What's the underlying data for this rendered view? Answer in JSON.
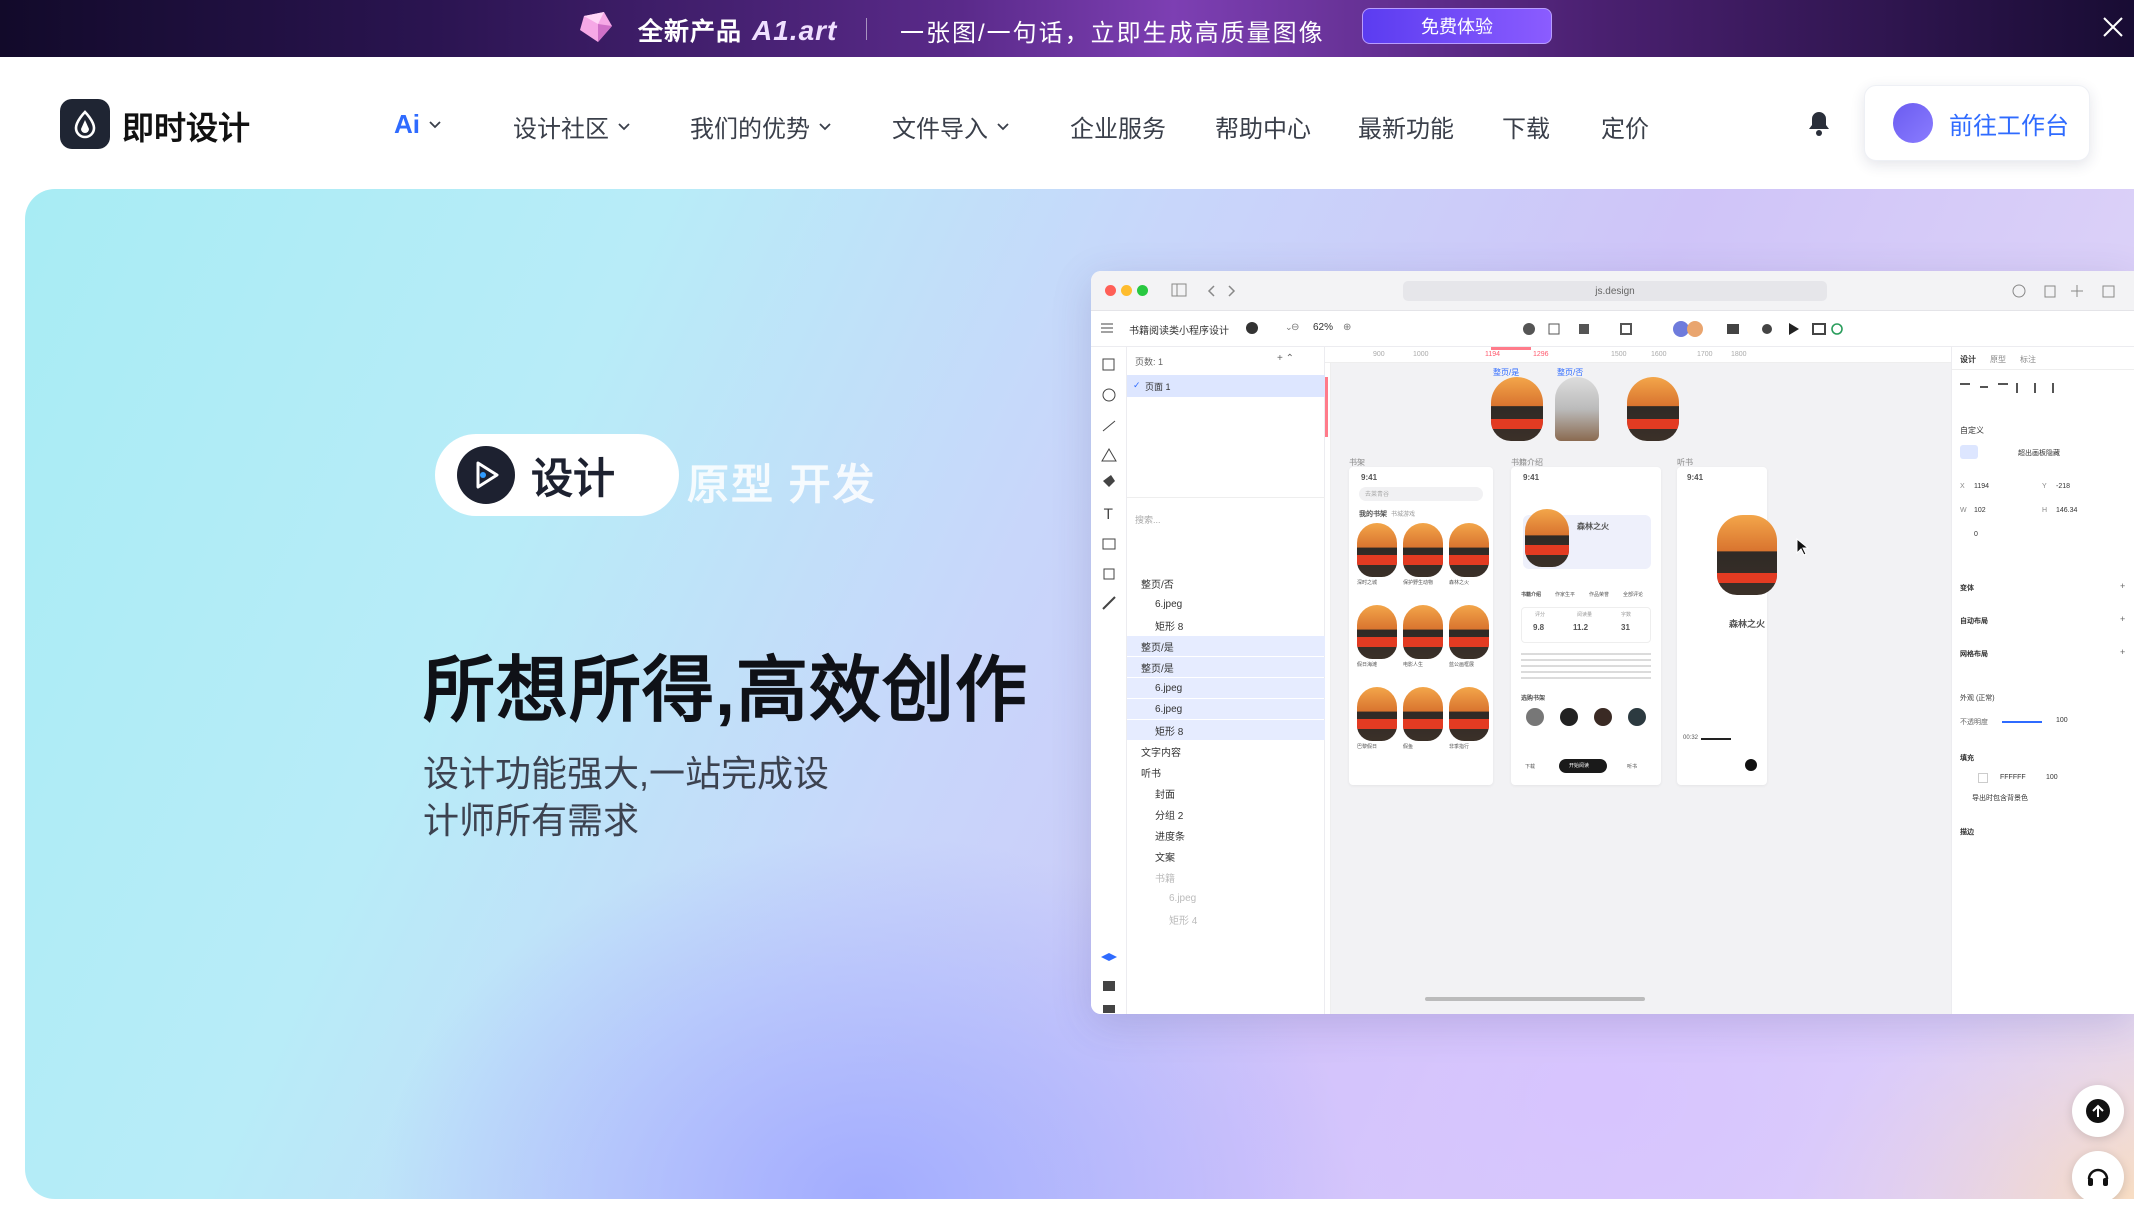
{
  "promo": {
    "title": "全新产品",
    "brand": "A1.art",
    "tagline": "一张图/一句话，立即生成高质量图像",
    "cta": "免费体验"
  },
  "nav": {
    "logo": "即时设计",
    "items": [
      {
        "label": "Ai",
        "dropdown": true
      },
      {
        "label": "设计社区",
        "dropdown": true
      },
      {
        "label": "我们的优势",
        "dropdown": true
      },
      {
        "label": "文件导入",
        "dropdown": true
      },
      {
        "label": "企业服务",
        "dropdown": false
      },
      {
        "label": "帮助中心",
        "dropdown": false
      },
      {
        "label": "最新功能",
        "dropdown": false
      },
      {
        "label": "下载",
        "dropdown": false
      },
      {
        "label": "定价",
        "dropdown": false
      }
    ],
    "workspace_button": "前往工作台"
  },
  "hero": {
    "pill_label": "设计",
    "pill_rest": "原型 开发",
    "headline": "所想所得,高效创作",
    "subline": "设计功能强大,一站完成设计师所有需求"
  },
  "app": {
    "url": "js.design",
    "file_name": "书籍阅读类小程序设计",
    "zoom": "62%",
    "pages_label": "页数: 1",
    "page1": "页面 1",
    "search_placeholder": "搜索...",
    "layers": [
      {
        "label": "整页/否",
        "indent": 0
      },
      {
        "label": "6.jpeg",
        "indent": 1
      },
      {
        "label": "矩形 8",
        "indent": 1
      },
      {
        "label": "整页/是",
        "indent": 0
      },
      {
        "label": "整页/是",
        "indent": 0
      },
      {
        "label": "6.jpeg",
        "indent": 1
      },
      {
        "label": "6.jpeg",
        "indent": 1
      },
      {
        "label": "矩形 8",
        "indent": 1
      },
      {
        "label": "文字内容",
        "indent": 0
      },
      {
        "label": "听书",
        "indent": 0
      },
      {
        "label": "封面",
        "indent": 1
      },
      {
        "label": "分组 2",
        "indent": 1
      },
      {
        "label": "进度条",
        "indent": 1
      },
      {
        "label": "文案",
        "indent": 1
      },
      {
        "label": "书籍",
        "indent": 1
      },
      {
        "label": "6.jpeg",
        "indent": 2
      },
      {
        "label": "矩形 4",
        "indent": 2
      }
    ],
    "ruler_ticks": [
      "900",
      "1000",
      "1194",
      "1296",
      "1500",
      "1600",
      "1700",
      "1800"
    ],
    "frames": {
      "top_a": "整页/是",
      "top_b": "整页/否",
      "f1": "书架",
      "f2": "书籍介绍",
      "f3": "听书"
    },
    "shelf": {
      "time": "9:41",
      "search": "去莱青谷",
      "tab1": "我的书架",
      "tab2": "书城游戏",
      "books": [
        "深时之城",
        "保护野生动物",
        "森林之火",
        "假日海滩",
        "电影人生",
        "蓝公画框展",
        "巴黎假日",
        "假鱼",
        "非季指行"
      ]
    },
    "detail": {
      "time": "9:41",
      "title": "森林之火",
      "tabs": [
        "书籍介绍",
        "作家生平",
        "作品荣誉",
        "全部评论"
      ],
      "score": "9.8",
      "readers": "11.2",
      "words": "31",
      "score_label": "评分",
      "readers_label": "阅读量",
      "words_label": "字数",
      "section": "选购书架",
      "btn_download": "下载",
      "btn_read": "开始阅读",
      "btn_listen": "听书"
    },
    "listen": {
      "time": "9:41",
      "title": "森林之火",
      "progress": "00:32"
    },
    "panel": {
      "tabs": [
        "设计",
        "原型",
        "标注"
      ],
      "frame_type": "自定义",
      "clip": "超出画板隐藏",
      "x": "1194",
      "y": "-218",
      "w": "102",
      "h": "146.34",
      "rot": "0",
      "sections": [
        "变体",
        "自动布局",
        "网格布局"
      ],
      "appearance": "外观 (正常)",
      "opacity_label": "不透明度",
      "opacity": "100",
      "fill_label": "填充",
      "fill_hex": "FFFFFF",
      "fill_pct": "100",
      "export_bg": "导出时包含背景色",
      "stroke": "描边"
    }
  },
  "colors": {
    "accent": "#2f6bff",
    "dark": "#1f2533"
  }
}
